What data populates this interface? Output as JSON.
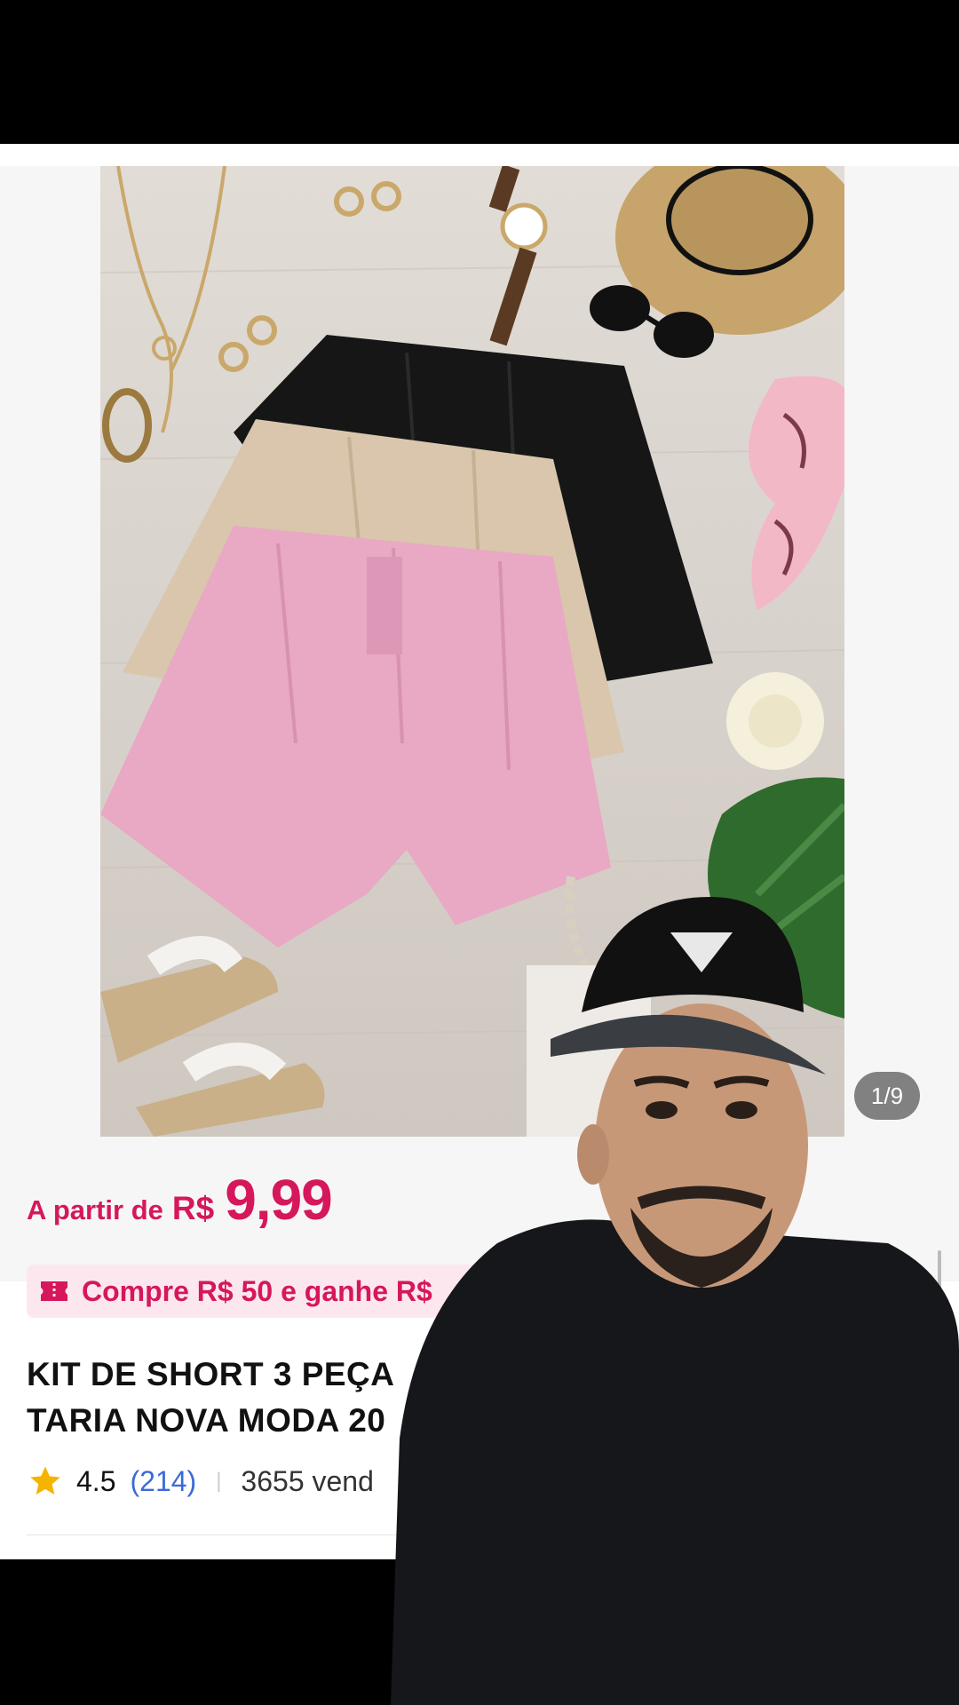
{
  "gallery": {
    "counter": "1/9"
  },
  "price": {
    "prefix": "A partir de",
    "currency": "R$",
    "value": "9,99"
  },
  "promo": {
    "text": "Compre R$ 50 e ganhe R$"
  },
  "product": {
    "title_line1": "KIT DE SHORT 3 PEÇA",
    "title_line2": "TARIA NOVA MODA 20"
  },
  "rating": {
    "value": "4.5",
    "count": "(214)",
    "sold": "3655 vend"
  },
  "colors": {
    "accent": "#d6175c",
    "link": "#3b6bd9",
    "star": "#f5b400"
  }
}
